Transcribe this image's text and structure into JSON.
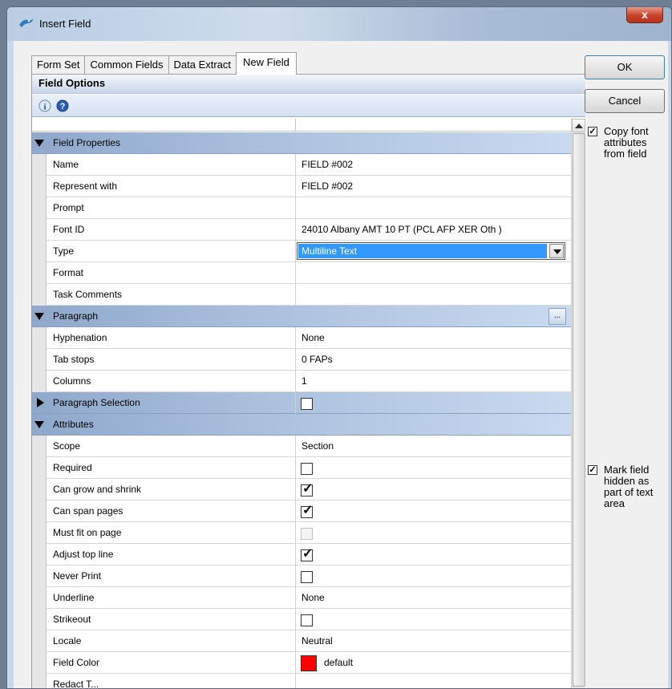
{
  "window": {
    "title": "Insert Field",
    "close_glyph": "x"
  },
  "tabs": [
    {
      "label": "Form Set",
      "active": false
    },
    {
      "label": "Common Fields",
      "active": false
    },
    {
      "label": "Data Extract",
      "active": false
    },
    {
      "label": "New Field",
      "active": true
    }
  ],
  "panel": {
    "header": "Field Options",
    "toolbar_icons": [
      "info-icon",
      "help-icon"
    ]
  },
  "rows": [
    {
      "type": "category",
      "name": "Field Properties",
      "expanded": true
    },
    {
      "type": "text",
      "name": "Name",
      "value": "FIELD #002"
    },
    {
      "type": "text",
      "name": "Represent with",
      "value": "FIELD #002"
    },
    {
      "type": "text",
      "name": "Prompt",
      "value": ""
    },
    {
      "type": "text",
      "name": "Font ID",
      "value": "24010 Albany AMT 10 PT (PCL AFP XER Oth )"
    },
    {
      "type": "combo",
      "name": "Type",
      "value": "Multiline Text"
    },
    {
      "type": "text",
      "name": "Format",
      "value": ""
    },
    {
      "type": "text",
      "name": "Task Comments",
      "value": ""
    },
    {
      "type": "category",
      "name": "Paragraph",
      "expanded": true,
      "ellipsis": "..."
    },
    {
      "type": "text",
      "name": "Hyphenation",
      "value": "None"
    },
    {
      "type": "text",
      "name": "Tab stops",
      "value": "0 FAPs"
    },
    {
      "type": "text",
      "name": "Columns",
      "value": "1"
    },
    {
      "type": "category-check",
      "name": "Paragraph Selection",
      "expanded": false,
      "checked": false
    },
    {
      "type": "category",
      "name": "Attributes",
      "expanded": true
    },
    {
      "type": "text",
      "name": "Scope",
      "value": "Section"
    },
    {
      "type": "check",
      "name": "Required",
      "checked": false
    },
    {
      "type": "check",
      "name": "Can grow and shrink",
      "checked": true
    },
    {
      "type": "check",
      "name": "Can span pages",
      "checked": true
    },
    {
      "type": "check",
      "name": "Must fit on page",
      "checked": false,
      "disabled": true
    },
    {
      "type": "check",
      "name": "Adjust top line",
      "checked": true
    },
    {
      "type": "check",
      "name": "Never Print",
      "checked": false
    },
    {
      "type": "text",
      "name": "Underline",
      "value": "None"
    },
    {
      "type": "check",
      "name": "Strikeout",
      "checked": false
    },
    {
      "type": "text",
      "name": "Locale",
      "value": "Neutral"
    },
    {
      "type": "color",
      "name": "Field Color",
      "value": "default",
      "color": "#ff0000"
    },
    {
      "type": "text",
      "name": "Redact T...",
      "value": ""
    }
  ],
  "buttons": {
    "ok": "OK",
    "cancel": "Cancel"
  },
  "side_checks": [
    {
      "label": "Copy font attributes from field",
      "checked": true
    },
    {
      "label": "Mark field hidden as part of text area",
      "checked": true
    }
  ],
  "colors": {
    "category_header": "#a9bfdc",
    "selection": "#3399ff",
    "close_button": "#c7412b"
  }
}
